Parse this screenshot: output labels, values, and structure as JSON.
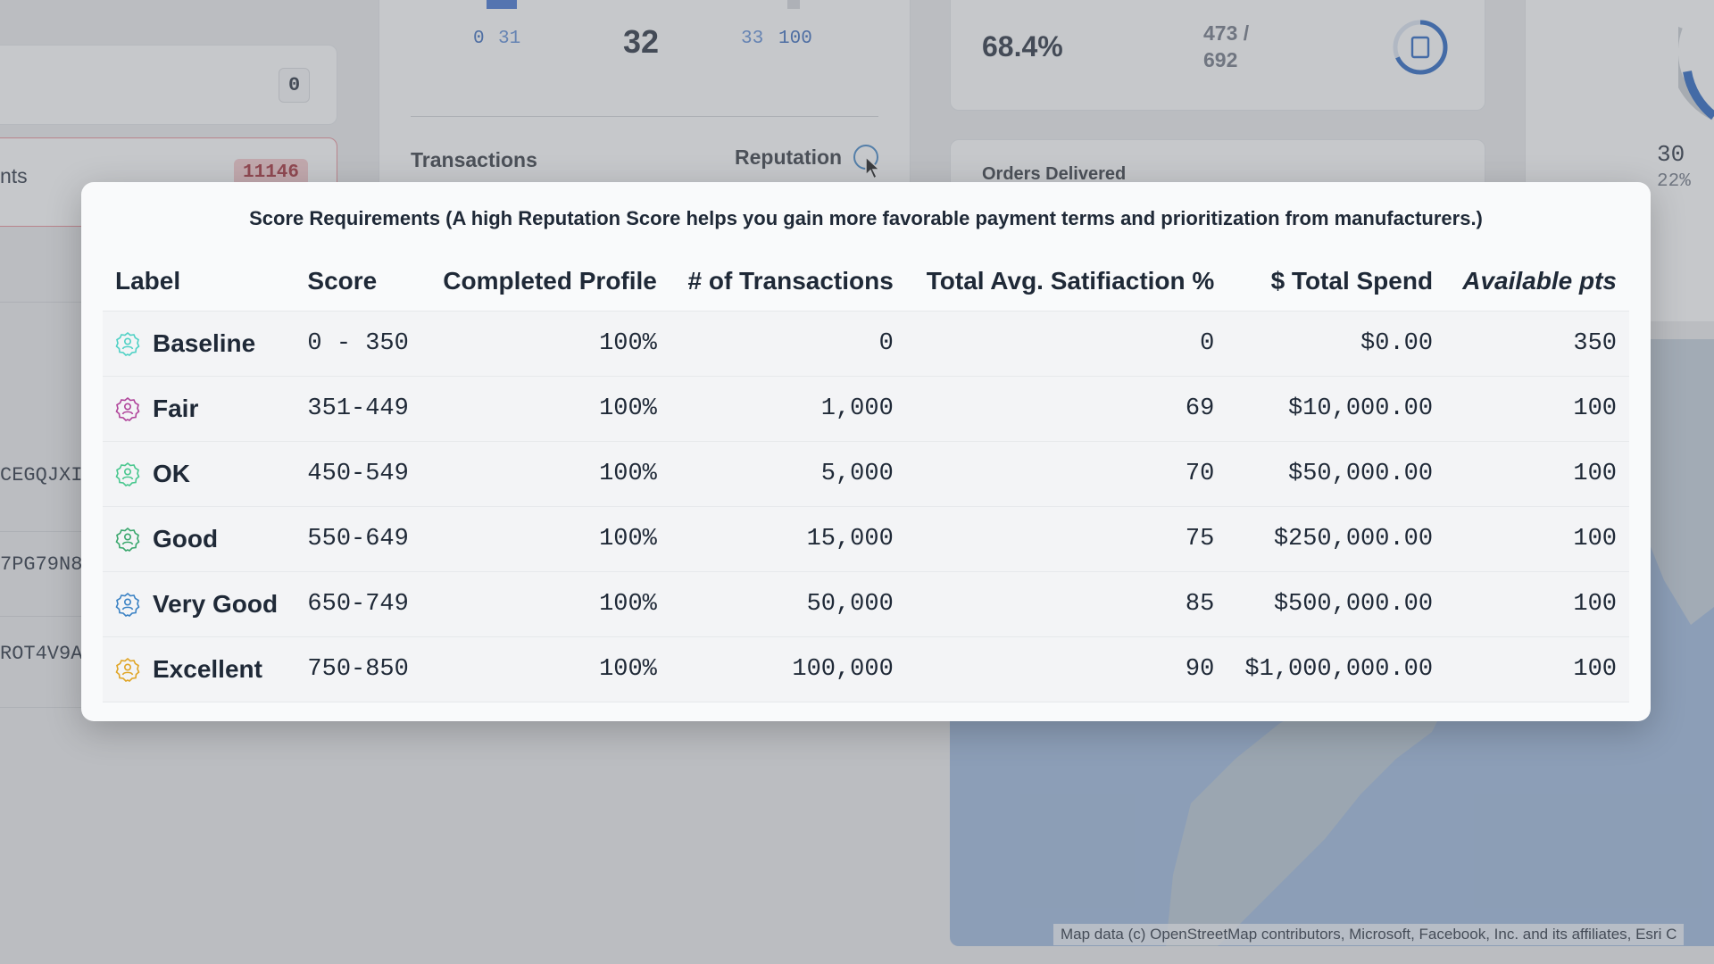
{
  "background": {
    "left_badge_zero": "0",
    "left_red_badge": "11146",
    "left_label_fragment": "nts",
    "codes": [
      "CEGQJXI",
      "7PG79N8",
      "ROT4V9A"
    ],
    "range_left": [
      "0",
      "31"
    ],
    "range_right": [
      "33",
      "100"
    ],
    "center_value": "32",
    "transactions_label": "Transactions",
    "reputation_label": "Reputation",
    "kpi_percent": "68.4%",
    "kpi_fraction_top": "473 /",
    "kpi_fraction_bottom": "692",
    "orders_delivered_label": "Orders Delivered",
    "right_value": "30",
    "right_percent": "22%",
    "map_credit": "Map data (c) OpenStreetMap contributors, Microsoft, Facebook, Inc. and its affiliates, Esri C"
  },
  "modal": {
    "title": "Score Requirements (A high Reputation Score helps you gain more favorable payment terms and prioritization from manufacturers.)",
    "columns": [
      "Label",
      "Score",
      "Completed Profile",
      "# of Transactions",
      "Total Avg. Satifiaction %",
      "$ Total Spend",
      "Available pts"
    ],
    "rows": [
      {
        "label": "Baseline",
        "score": "0 - 350",
        "profile": "100%",
        "transactions": "0",
        "satisfaction": "0",
        "spend": "$0.00",
        "pts": "350",
        "icon": "user-badge-icon",
        "color": "#4fd1c5"
      },
      {
        "label": "Fair",
        "score": "351-449",
        "profile": "100%",
        "transactions": "1,000",
        "satisfaction": "69",
        "spend": "$10,000.00",
        "pts": "100",
        "icon": "user-badge-icon",
        "color": "#b0449a"
      },
      {
        "label": "OK",
        "score": "450-549",
        "profile": "100%",
        "transactions": "5,000",
        "satisfaction": "70",
        "spend": "$50,000.00",
        "pts": "100",
        "icon": "user-badge-icon",
        "color": "#48c78e"
      },
      {
        "label": "Good",
        "score": "550-649",
        "profile": "100%",
        "transactions": "15,000",
        "satisfaction": "75",
        "spend": "$250,000.00",
        "pts": "100",
        "icon": "user-badge-icon",
        "color": "#3aa76d"
      },
      {
        "label": "Very Good",
        "score": "650-749",
        "profile": "100%",
        "transactions": "50,000",
        "satisfaction": "85",
        "spend": "$500,000.00",
        "pts": "100",
        "icon": "user-badge-icon",
        "color": "#3b82c4"
      },
      {
        "label": "Excellent",
        "score": "750-850",
        "profile": "100%",
        "transactions": "100,000",
        "satisfaction": "90",
        "spend": "$1,000,000.00",
        "pts": "100",
        "icon": "user-badge-icon",
        "color": "#e0a526"
      }
    ]
  }
}
